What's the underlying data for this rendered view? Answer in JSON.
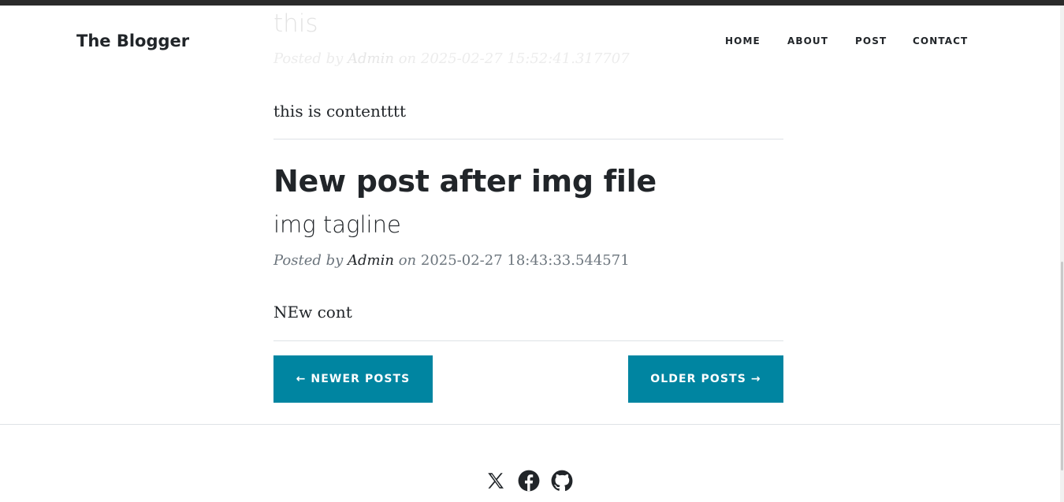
{
  "navbar": {
    "brand": "The Blogger",
    "links": [
      "HOME",
      "ABOUT",
      "POST",
      "CONTACT"
    ]
  },
  "posts": [
    {
      "title": "this",
      "meta_prefix": "Posted by",
      "author": "Admin",
      "meta_on": "on",
      "date": "2025-02-27 15:52:41.317707",
      "content": "this is contentttt"
    },
    {
      "title": "New post after img file",
      "subtitle": "img tagline",
      "meta_prefix": "Posted by",
      "author": "Admin",
      "meta_on": "on",
      "date": "2025-02-27 18:43:33.544571",
      "content": "NEw cont"
    }
  ],
  "pager": {
    "newer": "← NEWER POSTS",
    "older": "OLDER POSTS →"
  },
  "footer": {
    "social_icons": [
      "x-icon",
      "facebook-icon",
      "github-icon"
    ]
  },
  "colors": {
    "accent": "#0085a1",
    "text": "#212529",
    "muted": "#6c757d"
  }
}
